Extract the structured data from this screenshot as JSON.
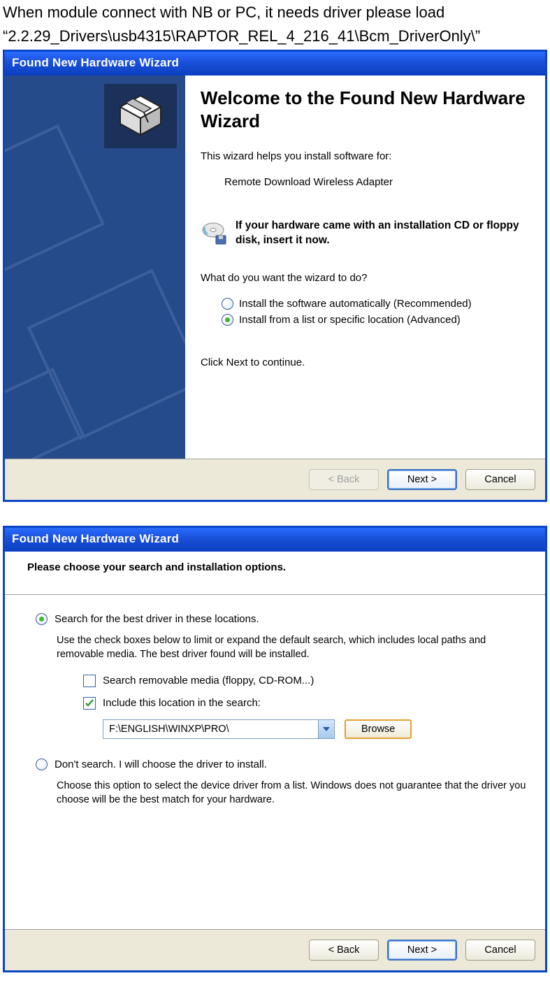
{
  "intro_line1": "When module connect with NB or PC, it needs driver please load",
  "intro_line2": "“2.2.29_Drivers\\usb4315\\RAPTOR_REL_4_216_41\\Bcm_DriverOnly\\”",
  "dialog1": {
    "title": "Found New Hardware Wizard",
    "heading": "Welcome to the Found New Hardware Wizard",
    "helps_text": "This wizard helps you install software for:",
    "device_name": "Remote Download Wireless Adapter",
    "cd_text": "If your hardware came with an installation CD or floppy disk, insert it now.",
    "what_do": "What do you want the wizard to do?",
    "radio_auto": "Install the software automatically (Recommended)",
    "radio_list": "Install from a list or specific location (Advanced)",
    "click_next": "Click Next to continue.",
    "buttons": {
      "back": "< Back",
      "next": "Next >",
      "cancel": "Cancel"
    }
  },
  "dialog2": {
    "title": "Found New Hardware Wizard",
    "header": "Please choose your search and installation options.",
    "opt_search": "Search for the best driver in these locations.",
    "opt_search_desc": "Use the check boxes below to limit or expand the default search, which includes local paths and removable media. The best driver found will be installed.",
    "chk_removable": "Search removable media (floppy, CD-ROM...)",
    "chk_location": "Include this location in the search:",
    "path_value": "F:\\ENGLISH\\WINXP\\PRO\\",
    "browse": "Browse",
    "opt_nosearch": "Don't search. I will choose the driver to install.",
    "opt_nosearch_desc": "Choose this option to select the device driver from a list.  Windows does not guarantee that the driver you choose will be the best match for your hardware.",
    "buttons": {
      "back": "< Back",
      "next": "Next >",
      "cancel": "Cancel"
    }
  }
}
